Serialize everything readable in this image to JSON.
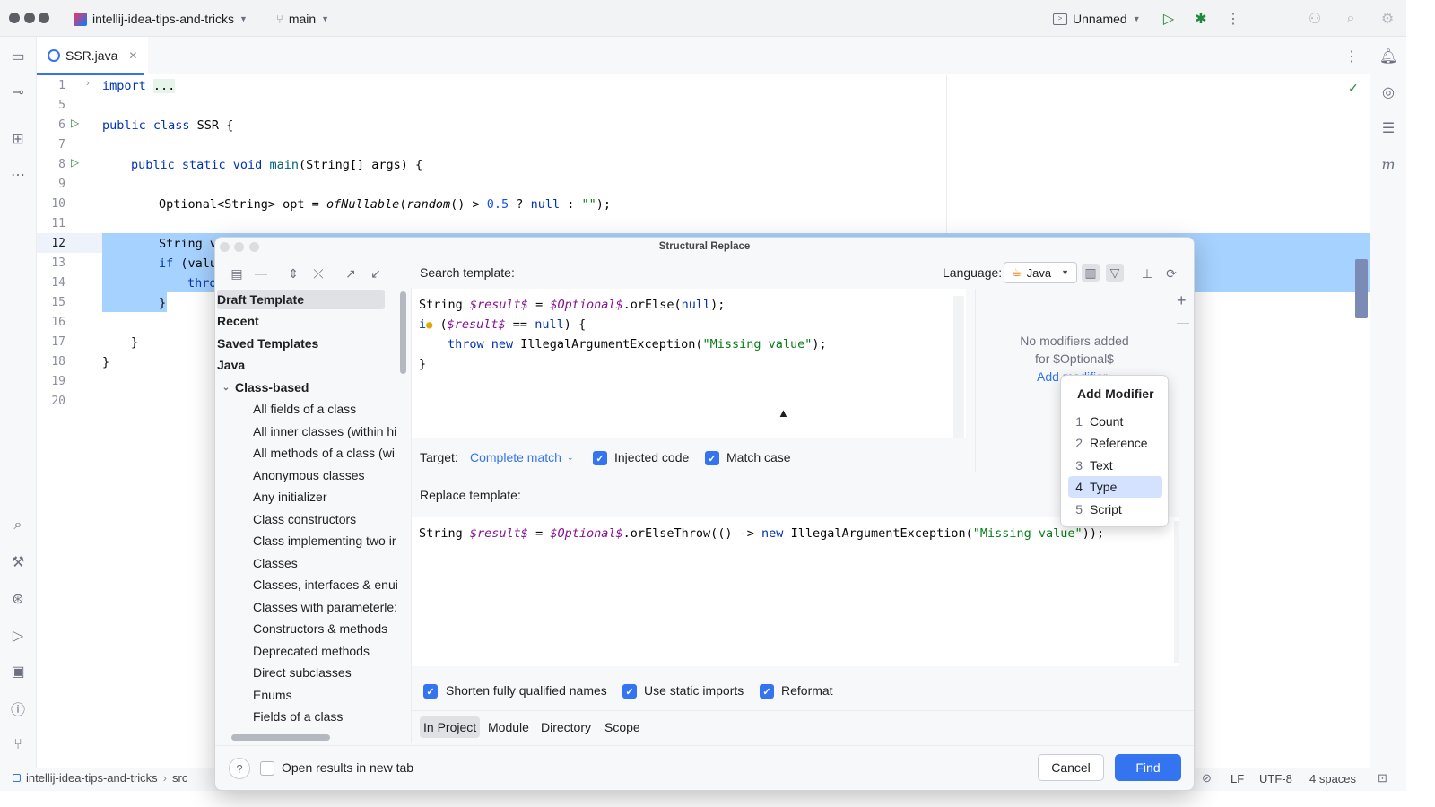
{
  "titlebar": {
    "project": "intellij-idea-tips-and-tricks",
    "branch": "main",
    "run_config": "Unnamed",
    "project_icon": "intellij-logo-icon",
    "branch_icon": "git-branch-icon"
  },
  "editor_tab": {
    "filename": "SSR.java"
  },
  "editor": {
    "line_numbers": [
      "1",
      "5",
      "6",
      "7",
      "8",
      "9",
      "10",
      "11",
      "12",
      "13",
      "14",
      "15",
      "16",
      "17",
      "18",
      "19",
      "20"
    ],
    "lines": {
      "l1_kw": "import",
      "l1_fold": "...",
      "l6_kw": "public class",
      "l6_rest": " SSR {",
      "l8_kw": "public static void",
      "l8_name": " main",
      "l8_rest": "(String[] args) {",
      "l10_a": "Optional<String> opt = ",
      "l10_call": "ofNullable",
      "l10_b": "(",
      "l10_rand": "random",
      "l10_c": "() > ",
      "l10_num": "0.5",
      "l10_d": " ? ",
      "l10_null": "null",
      "l10_e": " : ",
      "l10_str": "\"\"",
      "l10_f": ");",
      "l12": "String v",
      "l13_kw": "if",
      "l13_rest": " (valu",
      "l14": "thro",
      "l15": "}",
      "l17": "}",
      "l18": "}"
    }
  },
  "dialog": {
    "title": "Structural Replace",
    "search_label": "Search template:",
    "language_label": "Language:",
    "language_value": "Java",
    "tree": {
      "top": [
        "Draft Template",
        "Recent",
        "Saved Templates",
        "Java"
      ],
      "group": "Class-based",
      "items": [
        "All fields of a class",
        "All inner classes (within hi",
        "All methods of a class (wi",
        "Anonymous classes",
        "Any initializer",
        "Class constructors",
        "Class implementing two ir",
        "Classes",
        "Classes, interfaces & enui",
        "Classes with parameterle:",
        "Constructors & methods",
        "Deprecated methods",
        "Direct subclasses",
        "Enums",
        "Fields of a class"
      ]
    },
    "search_code": {
      "a1": "String ",
      "a2": "$result$",
      "a3": " = ",
      "a4": "$Optional$",
      "a5": ".orElse(",
      "a6": "null",
      "a7": ");",
      "b1": "i",
      "b2": " (",
      "b3": "$result$",
      "b4": " == ",
      "b5": "null",
      "b6": ") {",
      "c1": "throw new",
      "c2": " IllegalArgumentException(",
      "c3": "\"Missing value\"",
      "c4": ");",
      "d1": "}"
    },
    "modifiers": {
      "empty_line1": "No modifiers added",
      "empty_line2": "for $Optional$",
      "add_link": "Add modifier"
    },
    "target_label": "Target:",
    "target_value": "Complete match",
    "injected_code": "Injected code",
    "match_case": "Match case",
    "replace_label": "Replace template:",
    "replace_code": {
      "a1": "String ",
      "a2": "$result$",
      "a3": " = ",
      "a4": "$Optional$",
      "a5": ".orElseThrow(() -> ",
      "a6": "new",
      "a7": " IllegalArgumentException(",
      "a8": "\"Missing value\"",
      "a9": "));"
    },
    "shorten_fqn": "Shorten fully qualified names",
    "static_imports": "Use static imports",
    "reformat": "Reformat",
    "scopes": [
      "In Project",
      "Module",
      "Directory",
      "Scope"
    ],
    "open_new_tab": "Open results in new tab",
    "help": "?",
    "cancel": "Cancel",
    "find": "Find"
  },
  "popup": {
    "title": "Add Modifier",
    "items": [
      {
        "num": "1",
        "label": "Count"
      },
      {
        "num": "2",
        "label": "Reference"
      },
      {
        "num": "3",
        "label": "Text"
      },
      {
        "num": "4",
        "label": "Type"
      },
      {
        "num": "5",
        "label": "Script"
      }
    ]
  },
  "statusbar": {
    "breadcrumb": "intellij-idea-tips-and-tricks",
    "breadcrumb2": "src",
    "line_sep": "LF",
    "encoding": "UTF-8",
    "indent": "4 spaces"
  },
  "colors": {
    "accent": "#3574f0",
    "selection": "#a6d2ff",
    "keyword": "#0033b3",
    "string": "#067d17",
    "template_var": "#871094"
  }
}
